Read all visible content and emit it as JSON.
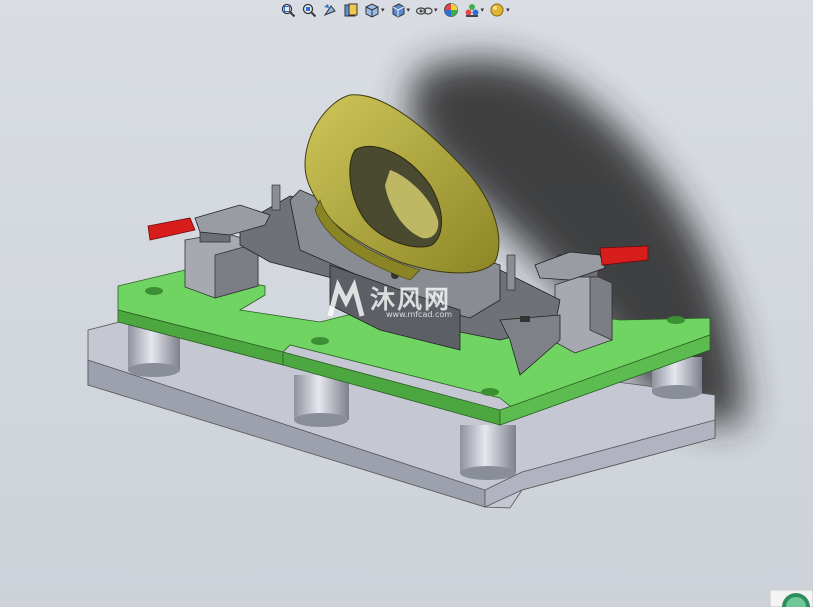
{
  "app": {
    "type": "cad-3d-viewport"
  },
  "toolbar": {
    "buttons": [
      {
        "name": "zoom-to-fit-icon",
        "dropdown": false
      },
      {
        "name": "zoom-to-area-icon",
        "dropdown": false
      },
      {
        "name": "previous-view-icon",
        "dropdown": false
      },
      {
        "name": "section-view-icon",
        "dropdown": false
      },
      {
        "name": "view-orientation-icon",
        "dropdown": true
      },
      {
        "name": "display-style-icon",
        "dropdown": true
      },
      {
        "name": "hide-show-items-icon",
        "dropdown": true
      },
      {
        "name": "edit-appearance-icon",
        "dropdown": false
      },
      {
        "name": "apply-scene-icon",
        "dropdown": true
      },
      {
        "name": "view-settings-icon",
        "dropdown": true
      }
    ],
    "dropdown_glyph": "▾"
  },
  "watermark": {
    "title": "沐风网",
    "url": "www.mfcad.com"
  },
  "colors": {
    "background": "#d0d4da",
    "base_plate": "#c9ccd7",
    "green_plate": "#69d05c",
    "fixture_gray": "#7d7f86",
    "part_yellow": "#b2ab3a",
    "clamp_red": "#d81d1d",
    "shadow": "#2b2b2b"
  }
}
